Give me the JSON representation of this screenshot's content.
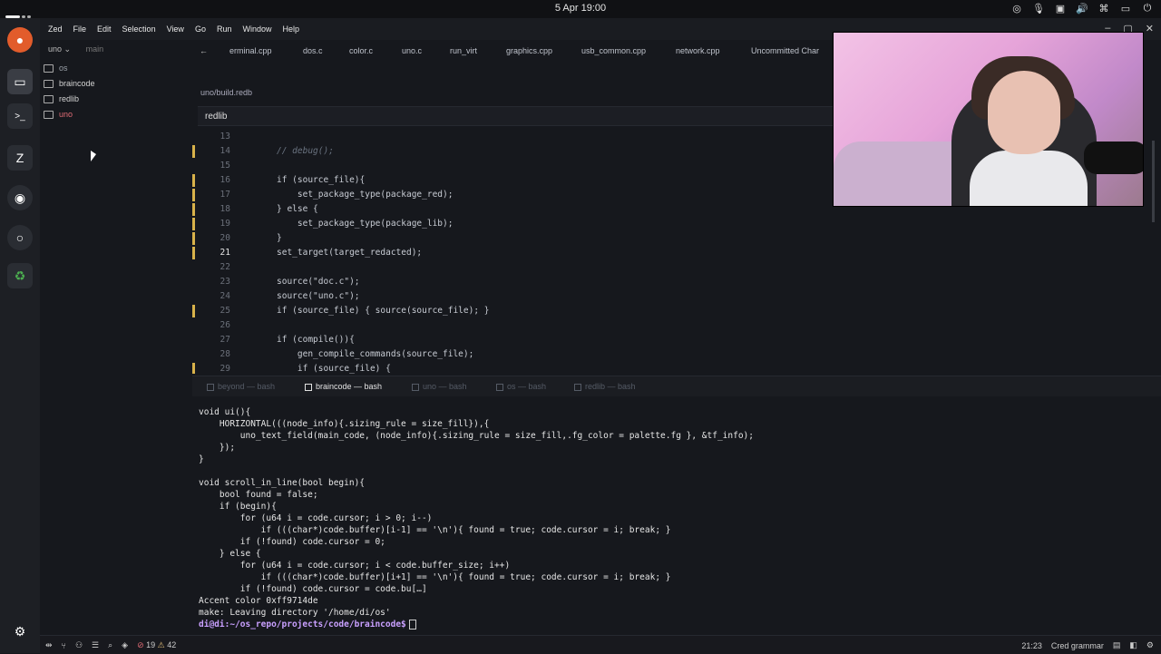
{
  "topbar": {
    "datetime": "5 Apr 19:00"
  },
  "menu": [
    "Zed",
    "File",
    "Edit",
    "Selection",
    "View",
    "Go",
    "Run",
    "Window",
    "Help"
  ],
  "project": {
    "name": "uno",
    "branch": "main"
  },
  "sidebar": {
    "items": [
      {
        "label": "os",
        "color": "#9aa0a8"
      },
      {
        "label": "braincode",
        "color": "#d4d4d4"
      },
      {
        "label": "redlib",
        "color": "#d4d4d4"
      },
      {
        "label": "uno",
        "color": "#e06c75"
      }
    ]
  },
  "tabs": [
    "erminal.cpp",
    "dos.c",
    "color.c",
    "uno.c",
    "run_virt",
    "graphics.cpp",
    "usb_common.cpp",
    "network.cpp",
    "Uncommitted Char"
  ],
  "breadcrumb": "uno/build.redb",
  "search_value": "redlib",
  "code_lines": [
    {
      "n": "13",
      "t": "",
      "k": ""
    },
    {
      "n": "14",
      "t": "// debug();",
      "k": "c"
    },
    {
      "n": "15",
      "t": "",
      "k": ""
    },
    {
      "n": "16",
      "t": "if (source_file){",
      "k": ""
    },
    {
      "n": "17",
      "t": "    set_package_type(package_red);",
      "k": ""
    },
    {
      "n": "18",
      "t": "} else {",
      "k": ""
    },
    {
      "n": "19",
      "t": "    set_package_type(package_lib);",
      "k": ""
    },
    {
      "n": "20",
      "t": "}",
      "k": ""
    },
    {
      "n": "21",
      "t": "set_target(target_redacted);",
      "k": ""
    },
    {
      "n": "22",
      "t": "",
      "k": ""
    },
    {
      "n": "23",
      "t": "source(\"doc.c\");",
      "k": ""
    },
    {
      "n": "24",
      "t": "source(\"uno.c\");",
      "k": ""
    },
    {
      "n": "25",
      "t": "if (source_file) { source(source_file); }",
      "k": ""
    },
    {
      "n": "26",
      "t": "",
      "k": ""
    },
    {
      "n": "27",
      "t": "if (compile()){",
      "k": ""
    },
    {
      "n": "28",
      "t": "    gen_compile_commands(source_file);",
      "k": ""
    },
    {
      "n": "29",
      "t": "    if (source_file) {",
      "k": ""
    }
  ],
  "current_line": "21",
  "terminal_tabs": [
    "beyond — bash",
    "braincode — bash",
    "uno — bash",
    "os — bash",
    "redlib — bash"
  ],
  "active_terminal": "braincode — bash",
  "terminal_lines": [
    "void ui(){",
    "    HORIZONTAL(((node_info){.sizing_rule = size_fill}),{",
    "        uno_text_field(main_code, (node_info){.sizing_rule = size_fill,.fg_color = palette.fg }, &tf_info);",
    "    });",
    "}",
    "",
    "void scroll_in_line(bool begin){",
    "    bool found = false;",
    "    if (begin){",
    "        for (u64 i = code.cursor; i > 0; i--)",
    "            if (((char*)code.buffer)[i-1] == '\\n'){ found = true; code.cursor = i; break; }",
    "        if (!found) code.cursor = 0;",
    "    } else {",
    "        for (u64 i = code.cursor; i < code.buffer_size; i++)",
    "            if (((char*)code.buffer)[i+1] == '\\n'){ found = true; code.cursor = i; break; }",
    "        if (!found) code.cursor = code.bu[…]",
    "Accent color 0xff9714de",
    "make: Leaving directory '/home/di/os'"
  ],
  "prompt": "di@di:~/os_repo/projects/code/braincode$",
  "status": {
    "errors": "19",
    "warnings": "42",
    "position": "21:23",
    "language": "Cred grammar"
  }
}
